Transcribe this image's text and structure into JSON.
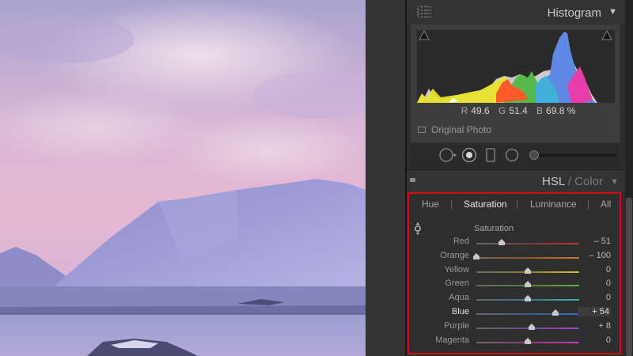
{
  "histogram": {
    "title": "Histogram",
    "readout": {
      "r_label": "R",
      "r": "49.6",
      "g_label": "G",
      "g": "51.4",
      "b_label": "B",
      "b": "69.8",
      "unit": "%"
    },
    "original_photo_label": "Original Photo"
  },
  "hsl": {
    "title_active": "HSL",
    "title_sep": "/",
    "title_inactive": "Color",
    "tabs": [
      "Hue",
      "Saturation",
      "Luminance",
      "All"
    ],
    "active_tab": "Saturation",
    "section_label": "Saturation",
    "sliders": [
      {
        "label": "Red",
        "value": "– 51",
        "position": 0.245
      },
      {
        "label": "Orange",
        "value": "– 100",
        "position": 0.0
      },
      {
        "label": "Yellow",
        "value": "0",
        "position": 0.5
      },
      {
        "label": "Green",
        "value": "0",
        "position": 0.5
      },
      {
        "label": "Aqua",
        "value": "0",
        "position": 0.5
      },
      {
        "label": "Blue",
        "value": "+ 54",
        "position": 0.77,
        "active": true
      },
      {
        "label": "Purple",
        "value": "+ 8",
        "position": 0.54
      },
      {
        "label": "Magenta",
        "value": "0",
        "position": 0.5
      }
    ]
  },
  "colors": {
    "highlight_border": "#d01010",
    "panel_bg": "#2e2e2e"
  }
}
